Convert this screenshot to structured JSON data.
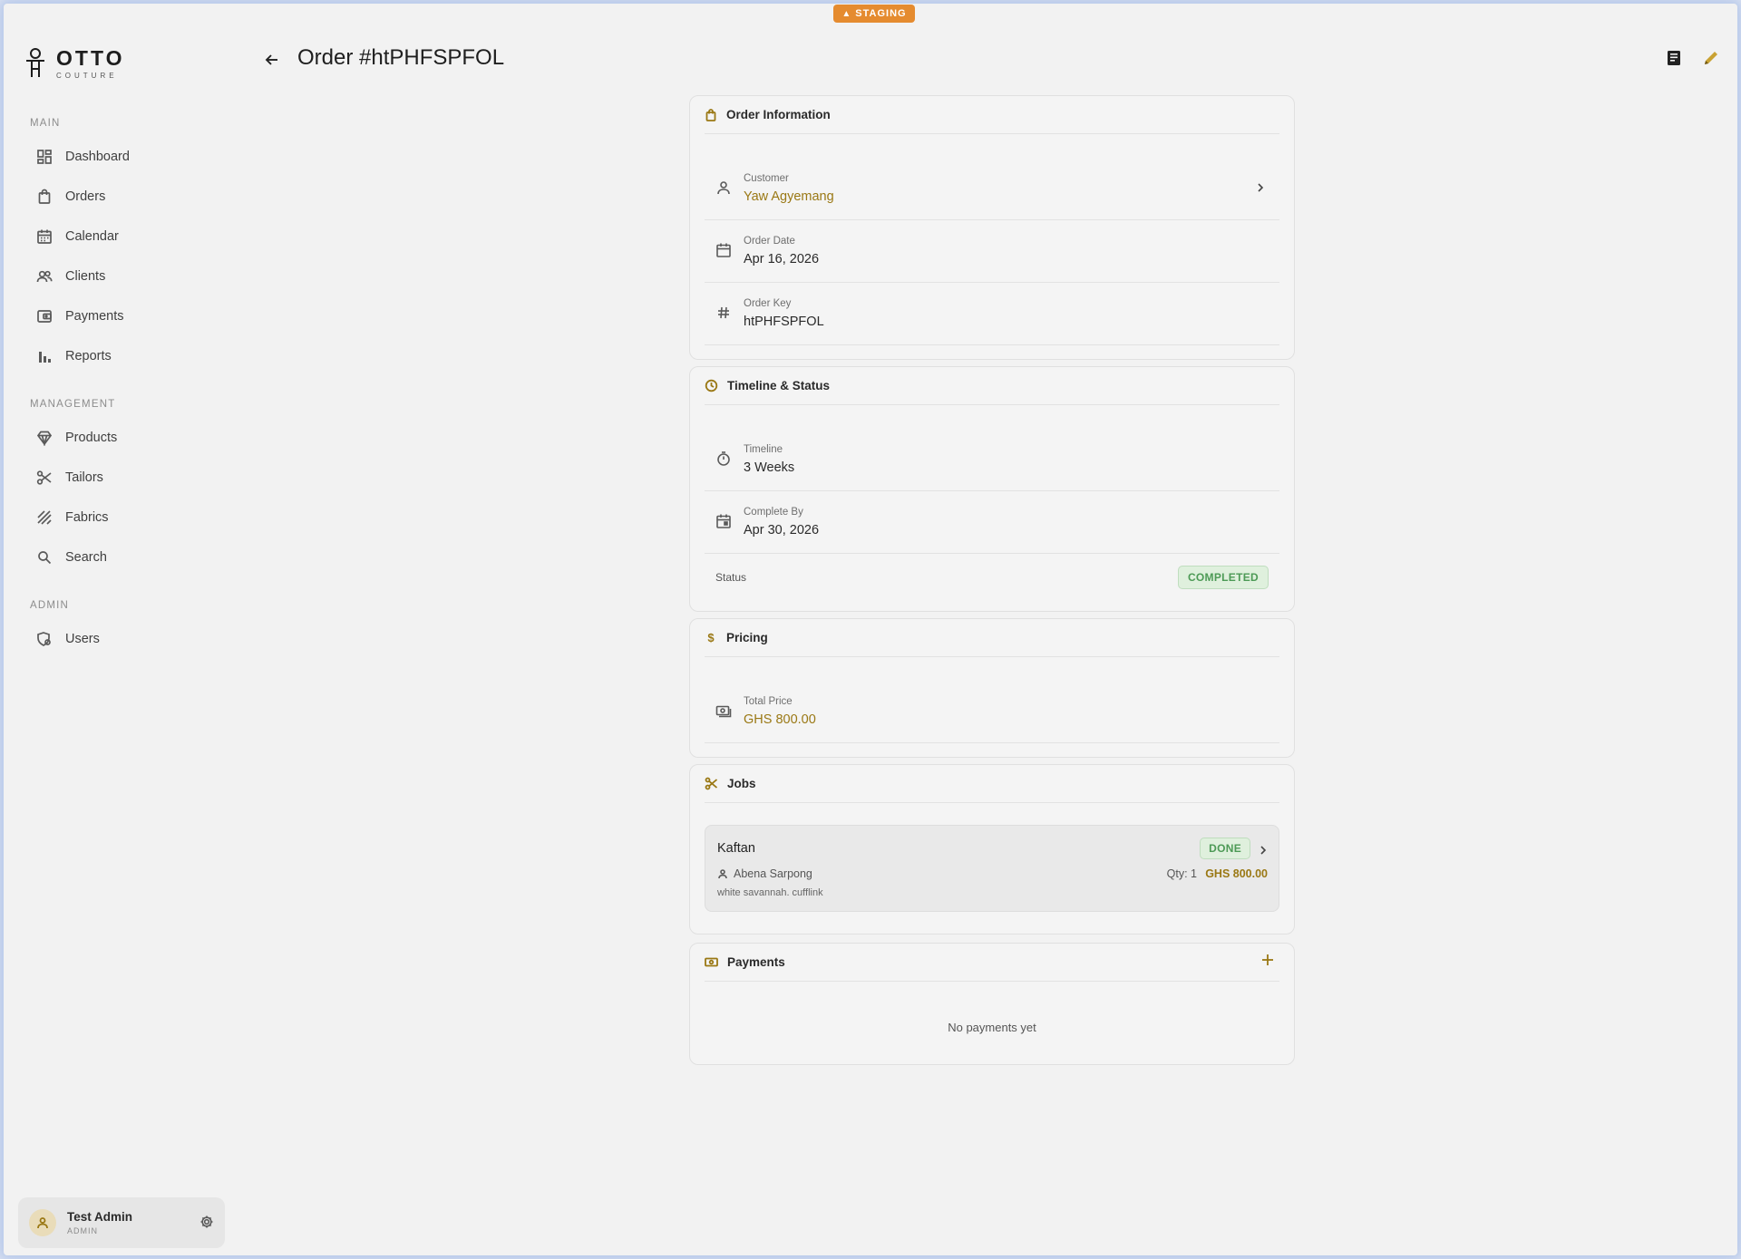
{
  "env_badge": "STAGING",
  "brand": {
    "name": "OTTO",
    "tagline": "COUTURE"
  },
  "sidebar": {
    "sections": [
      {
        "label": "MAIN",
        "items": [
          {
            "label": "Dashboard",
            "icon": "grid-icon"
          },
          {
            "label": "Orders",
            "icon": "bag-icon"
          },
          {
            "label": "Calendar",
            "icon": "calendar-icon"
          },
          {
            "label": "Clients",
            "icon": "users-icon"
          },
          {
            "label": "Payments",
            "icon": "wallet-icon"
          },
          {
            "label": "Reports",
            "icon": "bar-chart-icon"
          }
        ]
      },
      {
        "label": "MANAGEMENT",
        "items": [
          {
            "label": "Products",
            "icon": "diamond-icon"
          },
          {
            "label": "Tailors",
            "icon": "scissors-icon"
          },
          {
            "label": "Fabrics",
            "icon": "texture-icon"
          },
          {
            "label": "Search",
            "icon": "search-icon"
          }
        ]
      },
      {
        "label": "ADMIN",
        "items": [
          {
            "label": "Users",
            "icon": "user-shield-icon"
          }
        ]
      }
    ]
  },
  "user": {
    "name": "Test Admin",
    "role": "ADMIN"
  },
  "header": {
    "title": "Order #htPHFSPFOL"
  },
  "order_info": {
    "title": "Order Information",
    "customer_label": "Customer",
    "customer_value": "Yaw Agyemang",
    "date_label": "Order Date",
    "date_value": "Apr 16, 2026",
    "key_label": "Order Key",
    "key_value": "htPHFSPFOL"
  },
  "timeline": {
    "title": "Timeline & Status",
    "timeline_label": "Timeline",
    "timeline_value": "3 Weeks",
    "complete_label": "Complete By",
    "complete_value": "Apr 30, 2026",
    "status_label": "Status",
    "status_value": "COMPLETED"
  },
  "pricing": {
    "title": "Pricing",
    "total_label": "Total Price",
    "total_value": "GHS 800.00"
  },
  "jobs": {
    "title": "Jobs",
    "items": [
      {
        "name": "Kaftan",
        "status": "DONE",
        "assignee": "Abena Sarpong",
        "description": "white savannah. cufflink",
        "qty": "Qty: 1",
        "price": "GHS 800.00"
      }
    ]
  },
  "payments": {
    "title": "Payments",
    "empty_text": "No payments yet"
  },
  "colors": {
    "accent": "#9a7814",
    "status_green": "#4d9a56",
    "staging": "#e58b2f"
  }
}
